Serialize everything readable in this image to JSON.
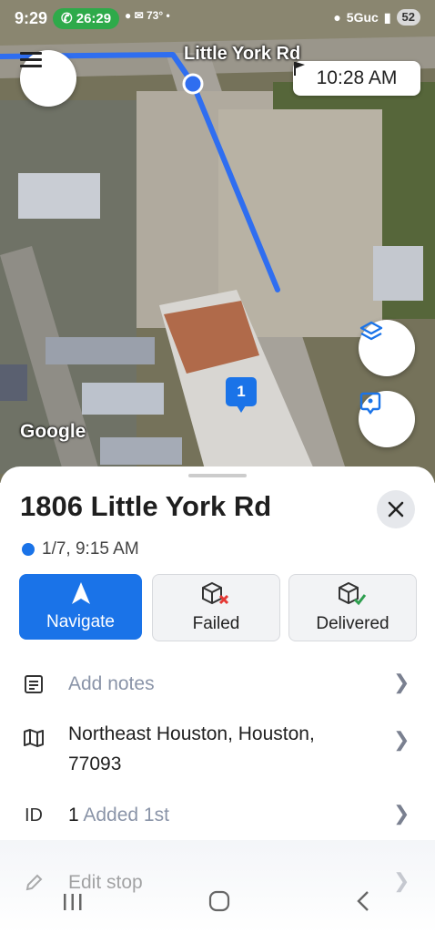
{
  "status_bar": {
    "time": "9:29",
    "call_timer": "26:29",
    "temperature": "73°",
    "network": "5Guc",
    "battery": "52"
  },
  "map": {
    "street_label": "Little York Rd",
    "arrival_time": "10:28 AM",
    "stop_marker_number": "1",
    "attribution": "Google"
  },
  "sheet": {
    "address": "1806 Little York Rd",
    "eta": "1/7, 9:15 AM",
    "actions": {
      "navigate": "Navigate",
      "failed": "Failed",
      "delivered": "Delivered"
    },
    "notes_placeholder": "Add notes",
    "location_line1": "Northeast Houston, Houston,",
    "location_line2": "77093",
    "id_label": "ID",
    "id_value": "1",
    "id_added": "Added 1st",
    "edit_stop": "Edit stop"
  },
  "colors": {
    "accent": "#1a73e8",
    "call_green": "#2eaa4a",
    "failed_red": "#e53935",
    "delivered_green": "#2e9e4f"
  }
}
